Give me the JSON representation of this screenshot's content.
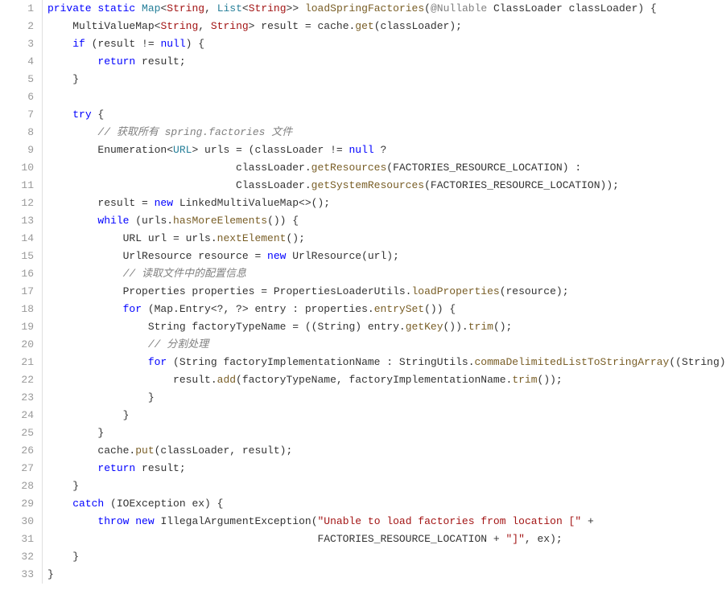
{
  "lineCount": 33,
  "tokens": {
    "l1": [
      {
        "t": "private",
        "c": "kw"
      },
      {
        "t": " ",
        "c": ""
      },
      {
        "t": "static",
        "c": "kw"
      },
      {
        "t": " ",
        "c": ""
      },
      {
        "t": "Map",
        "c": "type"
      },
      {
        "t": "<",
        "c": "punct"
      },
      {
        "t": "String",
        "c": "typeparam"
      },
      {
        "t": ", ",
        "c": "punct"
      },
      {
        "t": "List",
        "c": "type"
      },
      {
        "t": "<",
        "c": "punct"
      },
      {
        "t": "String",
        "c": "typeparam"
      },
      {
        "t": ">> ",
        "c": "punct"
      },
      {
        "t": "loadSpringFactories",
        "c": "method"
      },
      {
        "t": "(",
        "c": "punct"
      },
      {
        "t": "@Nullable",
        "c": "ann"
      },
      {
        "t": " ClassLoader classLoader) {",
        "c": "ident"
      }
    ],
    "l2": [
      {
        "t": "    MultiValueMap<",
        "c": "ident"
      },
      {
        "t": "String",
        "c": "typeparam"
      },
      {
        "t": ", ",
        "c": "punct"
      },
      {
        "t": "String",
        "c": "typeparam"
      },
      {
        "t": "> result = cache.",
        "c": "ident"
      },
      {
        "t": "get",
        "c": "method"
      },
      {
        "t": "(classLoader);",
        "c": "ident"
      }
    ],
    "l3": [
      {
        "t": "    ",
        "c": ""
      },
      {
        "t": "if",
        "c": "kw"
      },
      {
        "t": " (result != ",
        "c": "ident"
      },
      {
        "t": "null",
        "c": "kw"
      },
      {
        "t": ") {",
        "c": "ident"
      }
    ],
    "l4": [
      {
        "t": "        ",
        "c": ""
      },
      {
        "t": "return",
        "c": "kw"
      },
      {
        "t": " result;",
        "c": "ident"
      }
    ],
    "l5": [
      {
        "t": "    }",
        "c": "ident"
      }
    ],
    "l6": [
      {
        "t": "",
        "c": ""
      }
    ],
    "l7": [
      {
        "t": "    ",
        "c": ""
      },
      {
        "t": "try",
        "c": "kw"
      },
      {
        "t": " {",
        "c": "ident"
      }
    ],
    "l8": [
      {
        "t": "        ",
        "c": ""
      },
      {
        "t": "// 获取所有 spring.factories 文件",
        "c": "comment"
      }
    ],
    "l9": [
      {
        "t": "        Enumeration<",
        "c": "ident"
      },
      {
        "t": "URL",
        "c": "type"
      },
      {
        "t": "> urls = (classLoader != ",
        "c": "ident"
      },
      {
        "t": "null",
        "c": "kw"
      },
      {
        "t": " ?",
        "c": "ident"
      }
    ],
    "l10": [
      {
        "t": "                              classLoader.",
        "c": "ident"
      },
      {
        "t": "getResources",
        "c": "method"
      },
      {
        "t": "(FACTORIES_RESOURCE_LOCATION) :",
        "c": "ident"
      }
    ],
    "l11": [
      {
        "t": "                              ClassLoader.",
        "c": "ident"
      },
      {
        "t": "getSystemResources",
        "c": "method"
      },
      {
        "t": "(FACTORIES_RESOURCE_LOCATION));",
        "c": "ident"
      }
    ],
    "l12": [
      {
        "t": "        result = ",
        "c": "ident"
      },
      {
        "t": "new",
        "c": "kw"
      },
      {
        "t": " LinkedMultiValueMap<>();",
        "c": "ident"
      }
    ],
    "l13": [
      {
        "t": "        ",
        "c": ""
      },
      {
        "t": "while",
        "c": "kw"
      },
      {
        "t": " (urls.",
        "c": "ident"
      },
      {
        "t": "hasMoreElements",
        "c": "method"
      },
      {
        "t": "()) {",
        "c": "ident"
      }
    ],
    "l14": [
      {
        "t": "            URL url = urls.",
        "c": "ident"
      },
      {
        "t": "nextElement",
        "c": "method"
      },
      {
        "t": "();",
        "c": "ident"
      }
    ],
    "l15": [
      {
        "t": "            UrlResource resource = ",
        "c": "ident"
      },
      {
        "t": "new",
        "c": "kw"
      },
      {
        "t": " UrlResource(url);",
        "c": "ident"
      }
    ],
    "l16": [
      {
        "t": "            ",
        "c": ""
      },
      {
        "t": "// 读取文件中的配置信息",
        "c": "comment"
      }
    ],
    "l17": [
      {
        "t": "            Properties properties = PropertiesLoaderUtils.",
        "c": "ident"
      },
      {
        "t": "loadProperties",
        "c": "method"
      },
      {
        "t": "(resource);",
        "c": "ident"
      }
    ],
    "l18": [
      {
        "t": "            ",
        "c": ""
      },
      {
        "t": "for",
        "c": "kw"
      },
      {
        "t": " (Map.Entry<?, ?> entry : properties.",
        "c": "ident"
      },
      {
        "t": "entrySet",
        "c": "method"
      },
      {
        "t": "()) {",
        "c": "ident"
      }
    ],
    "l19": [
      {
        "t": "                String factoryTypeName = ((String) entry.",
        "c": "ident"
      },
      {
        "t": "getKey",
        "c": "method"
      },
      {
        "t": "()).",
        "c": "ident"
      },
      {
        "t": "trim",
        "c": "method"
      },
      {
        "t": "();",
        "c": "ident"
      }
    ],
    "l20": [
      {
        "t": "                ",
        "c": ""
      },
      {
        "t": "// 分割处理",
        "c": "comment"
      }
    ],
    "l21": [
      {
        "t": "                ",
        "c": ""
      },
      {
        "t": "for",
        "c": "kw"
      },
      {
        "t": " (String factoryImplementationName : StringUtils.",
        "c": "ident"
      },
      {
        "t": "commaDelimitedListToStringArray",
        "c": "method"
      },
      {
        "t": "((String) e",
        "c": "ident"
      }
    ],
    "l22": [
      {
        "t": "                    result.",
        "c": "ident"
      },
      {
        "t": "add",
        "c": "method"
      },
      {
        "t": "(factoryTypeName, factoryImplementationName.",
        "c": "ident"
      },
      {
        "t": "trim",
        "c": "method"
      },
      {
        "t": "());",
        "c": "ident"
      }
    ],
    "l23": [
      {
        "t": "                }",
        "c": "ident"
      }
    ],
    "l24": [
      {
        "t": "            }",
        "c": "ident"
      }
    ],
    "l25": [
      {
        "t": "        }",
        "c": "ident"
      }
    ],
    "l26": [
      {
        "t": "        cache.",
        "c": "ident"
      },
      {
        "t": "put",
        "c": "method"
      },
      {
        "t": "(classLoader, result);",
        "c": "ident"
      }
    ],
    "l27": [
      {
        "t": "        ",
        "c": ""
      },
      {
        "t": "return",
        "c": "kw"
      },
      {
        "t": " result;",
        "c": "ident"
      }
    ],
    "l28": [
      {
        "t": "    }",
        "c": "ident"
      }
    ],
    "l29": [
      {
        "t": "    ",
        "c": ""
      },
      {
        "t": "catch",
        "c": "kw"
      },
      {
        "t": " (IOException ex) {",
        "c": "ident"
      }
    ],
    "l30": [
      {
        "t": "        ",
        "c": ""
      },
      {
        "t": "throw",
        "c": "kw"
      },
      {
        "t": " ",
        "c": ""
      },
      {
        "t": "new",
        "c": "kw"
      },
      {
        "t": " IllegalArgumentException(",
        "c": "ident"
      },
      {
        "t": "\"Unable to load factories from location [\"",
        "c": "string"
      },
      {
        "t": " +",
        "c": "ident"
      }
    ],
    "l31": [
      {
        "t": "                                           FACTORIES_RESOURCE_LOCATION + ",
        "c": "ident"
      },
      {
        "t": "\"]\"",
        "c": "string"
      },
      {
        "t": ", ex);",
        "c": "ident"
      }
    ],
    "l32": [
      {
        "t": "    }",
        "c": "ident"
      }
    ],
    "l33": [
      {
        "t": "}",
        "c": "ident"
      }
    ]
  }
}
